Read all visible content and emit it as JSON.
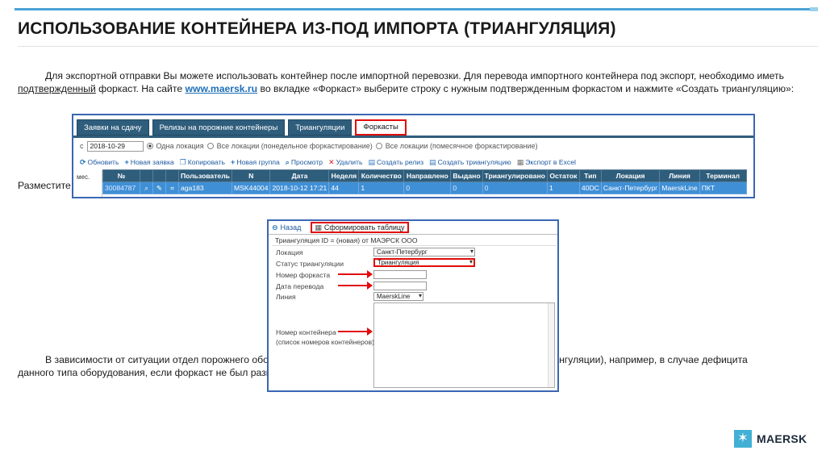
{
  "slide": {
    "title": "ИСПОЛЬЗОВАНИЕ КОНТЕЙНЕРА ИЗ-ПОД ИМПОРТА (ТРИАНГУЛЯЦИЯ)",
    "p1_a": "Для экспортной отправки Вы можете использовать контейнер после импортной перевозки. Для перевода импортного контейнера под экспорт, необходимо иметь",
    "p1_u": "подтвержденный",
    "p1_b": " форкаст. На сайте ",
    "p1_link": "www.maersk.ru",
    "p1_c": " во вкладке «Форкаст» выберите строку с нужным подтвержденным форкастом и нажмите «Создать триангуляцию»:",
    "p2": "Разместите з",
    "p3_a": "В зависимости от ситуации отдел порожнего обор",
    "p3_b": "ежим (триангуляции), например, в случае дефицита",
    "p3_c": "данного типа оборудования, если форкаст не был разме",
    "logo_text": "MAERSK"
  },
  "shot1": {
    "tabs": [
      "Заявки на сдачу",
      "Релизы на порожние контейнеры",
      "Триангуляции",
      "Форкасты"
    ],
    "date_value": "2018-10-29",
    "filter_prefix": "с",
    "radio1": "Одна локация",
    "radio2": "Все локации (понедельное форкастирование)",
    "radio3": "Все локации (помесячное форкастирование)",
    "toolbar": [
      "Обновить",
      "Новая заявка",
      "Копировать",
      "Новая группа",
      "Просмотр",
      "Удалить",
      "Создать релиз",
      "Создать триангуляцию",
      "Экспорт в Excel"
    ],
    "side_label": "мес.",
    "columns": [
      "№",
      "",
      "",
      "",
      "Пользователь",
      "N",
      "Дата",
      "Неделя",
      "Количество",
      "Направлено",
      "Выдано",
      "Триангулировано",
      "Остаток",
      "Тип",
      "Локация",
      "Линия",
      "Терминал"
    ],
    "row": [
      "30084787",
      "aga183",
      "MSK44004",
      "2018-10-12 17:21",
      "44",
      "1",
      "0",
      "0",
      "0",
      "1",
      "40DC",
      "Санкт-Петербург",
      "MaerskLine",
      "ПКТ"
    ]
  },
  "shot2": {
    "back": "Назад",
    "make_table": "Сформировать таблицу",
    "subtitle": "Триангуляция ID = (новая) от МАЭРСК ООО",
    "fields": {
      "location_label": "Локация",
      "location_value": "Санкт-Петербург",
      "status_label": "Статус триангуляции",
      "status_value": "Триангуляция",
      "forecast_label": "Номер форкаста",
      "date_label": "Дата перевода",
      "line_label": "Линия",
      "line_value": "MaerskLine",
      "container_label": "Номер контейнера",
      "container_hint": "(список номеров контейнеров)"
    }
  },
  "colors": {
    "accent_blue": "#4ba3d6",
    "frame_blue": "#3b67b2",
    "highlight_red": "#e10b0b",
    "tab_dark": "#2f5d7c",
    "row_blue": "#3f8fd6"
  },
  "icons": [
    "refresh-icon",
    "plus-icon",
    "copy-icon",
    "search-icon",
    "delete-icon",
    "back-icon",
    "table-icon",
    "maersk-star-icon"
  ]
}
